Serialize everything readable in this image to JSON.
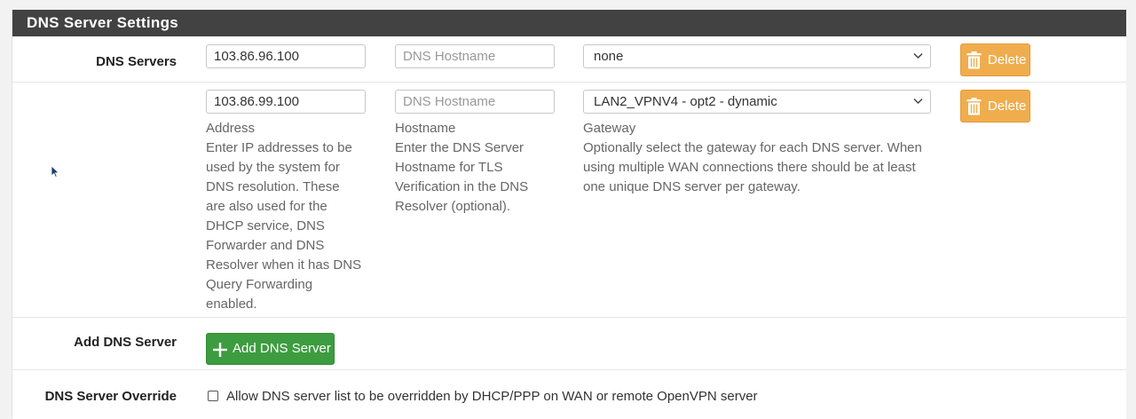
{
  "panel": {
    "title": "DNS Server Settings"
  },
  "dns_servers": {
    "label": "DNS Servers",
    "rows": [
      {
        "address": "103.86.96.100",
        "hostname_placeholder": "DNS Hostname",
        "gateway": "none",
        "delete_label": "Delete"
      },
      {
        "address": "103.86.99.100",
        "hostname_placeholder": "DNS Hostname",
        "gateway": "LAN2_VPNV4 - opt2 - dynamic",
        "delete_label": "Delete"
      }
    ],
    "help": {
      "address_title": "Address",
      "address_text": [
        "Enter IP addresses to be",
        "used by the system for",
        "DNS resolution. These",
        "are also used for the",
        "DHCP service, DNS",
        "Forwarder and DNS",
        "Resolver when it has DNS",
        "Query Forwarding",
        "enabled."
      ],
      "hostname_title": "Hostname",
      "hostname_text": [
        "Enter the DNS Server",
        "Hostname for TLS",
        "Verification in the DNS",
        "Resolver (optional)."
      ],
      "gateway_title": "Gateway",
      "gateway_text": [
        "Optionally select the gateway for each DNS server. When",
        "using multiple WAN connections there should be at least",
        "one unique DNS server per gateway."
      ]
    }
  },
  "add_dns": {
    "label": "Add DNS Server",
    "button_label": "Add DNS Server"
  },
  "override": {
    "label": "DNS Server Override",
    "checkbox_text": "Allow DNS server list to be overridden by DHCP/PPP on WAN or remote OpenVPN server",
    "checked": false
  },
  "colors": {
    "header": "#424242",
    "warning": "#f0ad4e",
    "success": "#3d9c3f"
  },
  "icons": {
    "delete": "trash-icon",
    "add": "plus-icon",
    "select": "chevron-down-icon",
    "pointer": "mouse-cursor-icon"
  }
}
